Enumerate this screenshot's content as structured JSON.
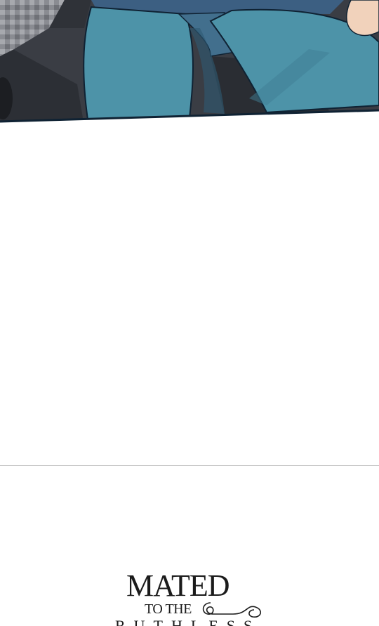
{
  "logo": {
    "line1": "MATED",
    "line2": "TO THE",
    "line3": "RUTHLESS"
  },
  "colors": {
    "jeans": "#4d93a8",
    "jeans_dark": "#3c5f82",
    "panel_bg": "#3a3d44",
    "outline": "#0f2233",
    "divider": "#c8c8c8"
  },
  "icons": [
    "flourish-icon"
  ]
}
